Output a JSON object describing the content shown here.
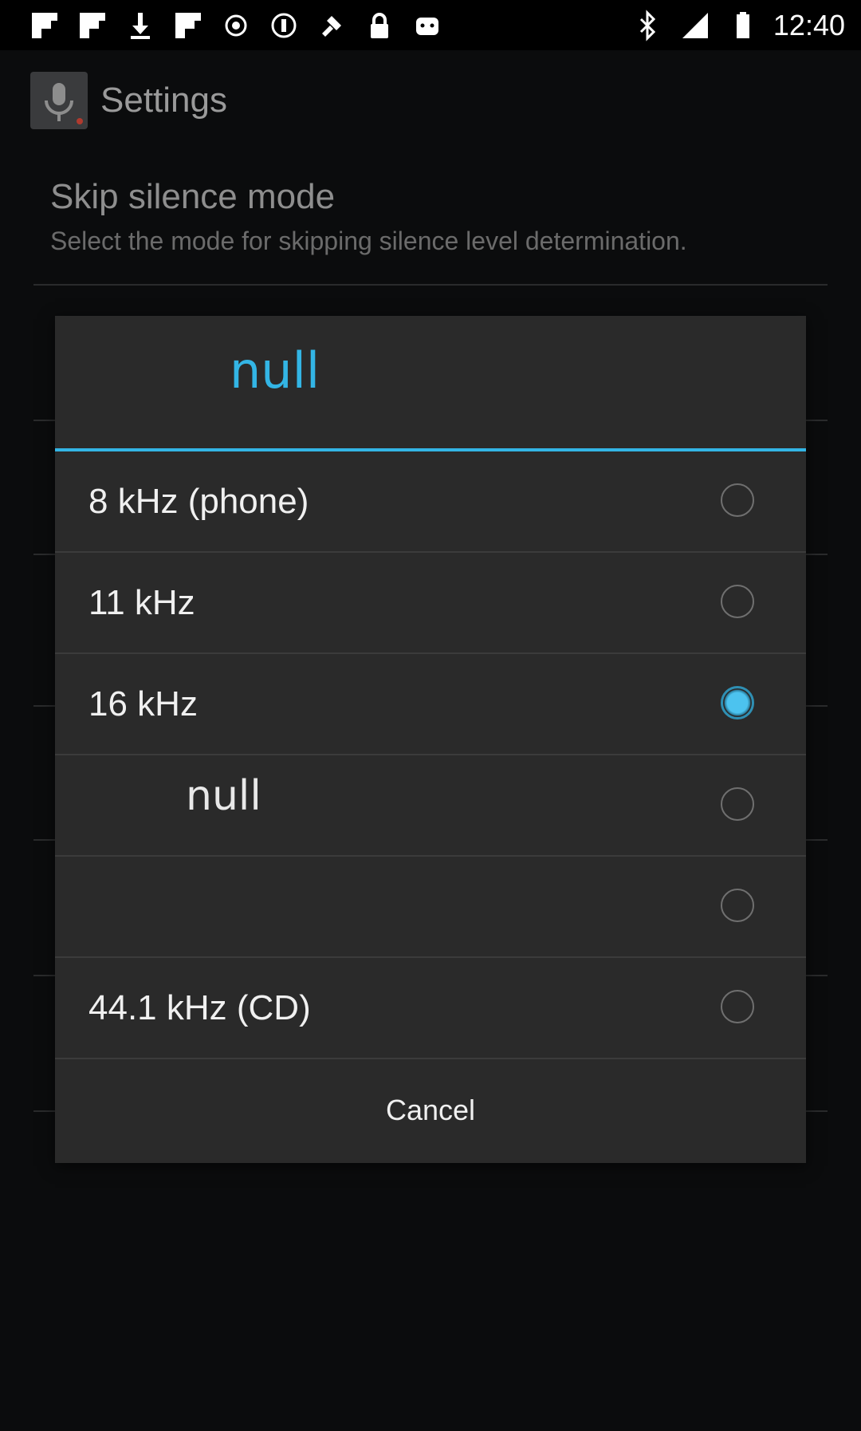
{
  "status_bar": {
    "time": "12:40",
    "left_icons": [
      "flipboard-icon",
      "flipboard-icon",
      "download-icon",
      "flipboard-icon",
      "circle-dot-icon",
      "circle-dot-icon",
      "fake-gps-icon",
      "lock-icon",
      "android-icon"
    ],
    "right_icons": [
      "bluetooth-icon",
      "signal-icon",
      "battery-icon"
    ]
  },
  "action_bar": {
    "title": "Settings",
    "icon": "microphone-icon"
  },
  "background_prefs": [
    {
      "title": "Skip silence mode",
      "summary": "Select the mode for skipping silence level determination."
    }
  ],
  "dialog": {
    "title": "null",
    "options": [
      {
        "label": "8 kHz (phone)",
        "checked": false
      },
      {
        "label": "11 kHz",
        "checked": false
      },
      {
        "label": "16 kHz",
        "checked": true
      },
      {
        "label": "null",
        "checked": false
      },
      {
        "label": "",
        "checked": false
      },
      {
        "label": "44.1 kHz (CD)",
        "checked": false
      }
    ],
    "cancel_label": "Cancel"
  },
  "colors": {
    "accent": "#33b5e5",
    "dialog_bg": "#2a2a2a",
    "screen_bg": "#0b0c0d"
  }
}
